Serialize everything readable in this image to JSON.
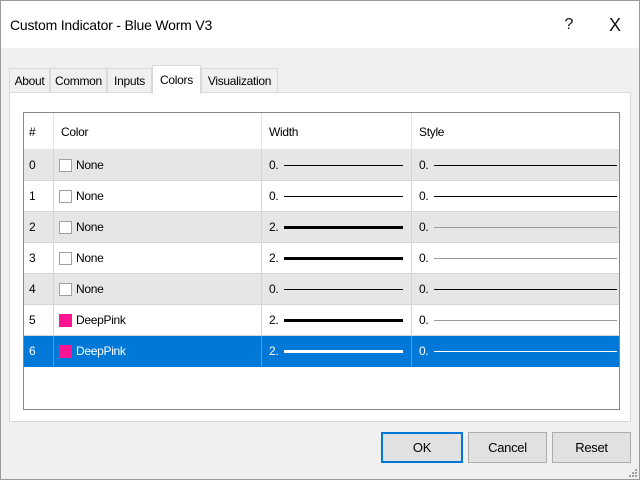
{
  "window": {
    "title": "Custom Indicator - Blue Worm V3",
    "help_label": "?",
    "close_label": "X"
  },
  "tabs": [
    {
      "label": "About",
      "active": false
    },
    {
      "label": "Common",
      "active": false
    },
    {
      "label": "Inputs",
      "active": false
    },
    {
      "label": "Colors",
      "active": true
    },
    {
      "label": "Visualization",
      "active": false
    }
  ],
  "table": {
    "columns": [
      "#",
      "Color",
      "Width",
      "Style"
    ],
    "rows": [
      {
        "index": "0",
        "color_name": "None",
        "color_hex": "#ffffff",
        "width": "0.",
        "style": "0.",
        "width_weight": "thin",
        "style_weight": "thin",
        "selected": false
      },
      {
        "index": "1",
        "color_name": "None",
        "color_hex": "#ffffff",
        "width": "0.",
        "style": "0.",
        "width_weight": "thin",
        "style_weight": "thin",
        "selected": false
      },
      {
        "index": "2",
        "color_name": "None",
        "color_hex": "#ffffff",
        "width": "2.",
        "style": "0.",
        "width_weight": "thick",
        "style_weight": "hairline",
        "selected": false
      },
      {
        "index": "3",
        "color_name": "None",
        "color_hex": "#ffffff",
        "width": "2.",
        "style": "0.",
        "width_weight": "thick",
        "style_weight": "hairline",
        "selected": false
      },
      {
        "index": "4",
        "color_name": "None",
        "color_hex": "#ffffff",
        "width": "0.",
        "style": "0.",
        "width_weight": "thin",
        "style_weight": "thin",
        "selected": false
      },
      {
        "index": "5",
        "color_name": "DeepPink",
        "color_hex": "#ff1493",
        "width": "2.",
        "style": "0.",
        "width_weight": "thick",
        "style_weight": "hairline",
        "selected": false
      },
      {
        "index": "6",
        "color_name": "DeepPink",
        "color_hex": "#ff1493",
        "width": "2.",
        "style": "0.",
        "width_weight": "thick",
        "style_weight": "hairline",
        "selected": true
      }
    ]
  },
  "buttons": {
    "ok": "OK",
    "cancel": "Cancel",
    "reset": "Reset"
  },
  "colors": {
    "selection": "#0078d7",
    "stripe": "#e6e6e6",
    "default_button_border": "#0078d7"
  }
}
